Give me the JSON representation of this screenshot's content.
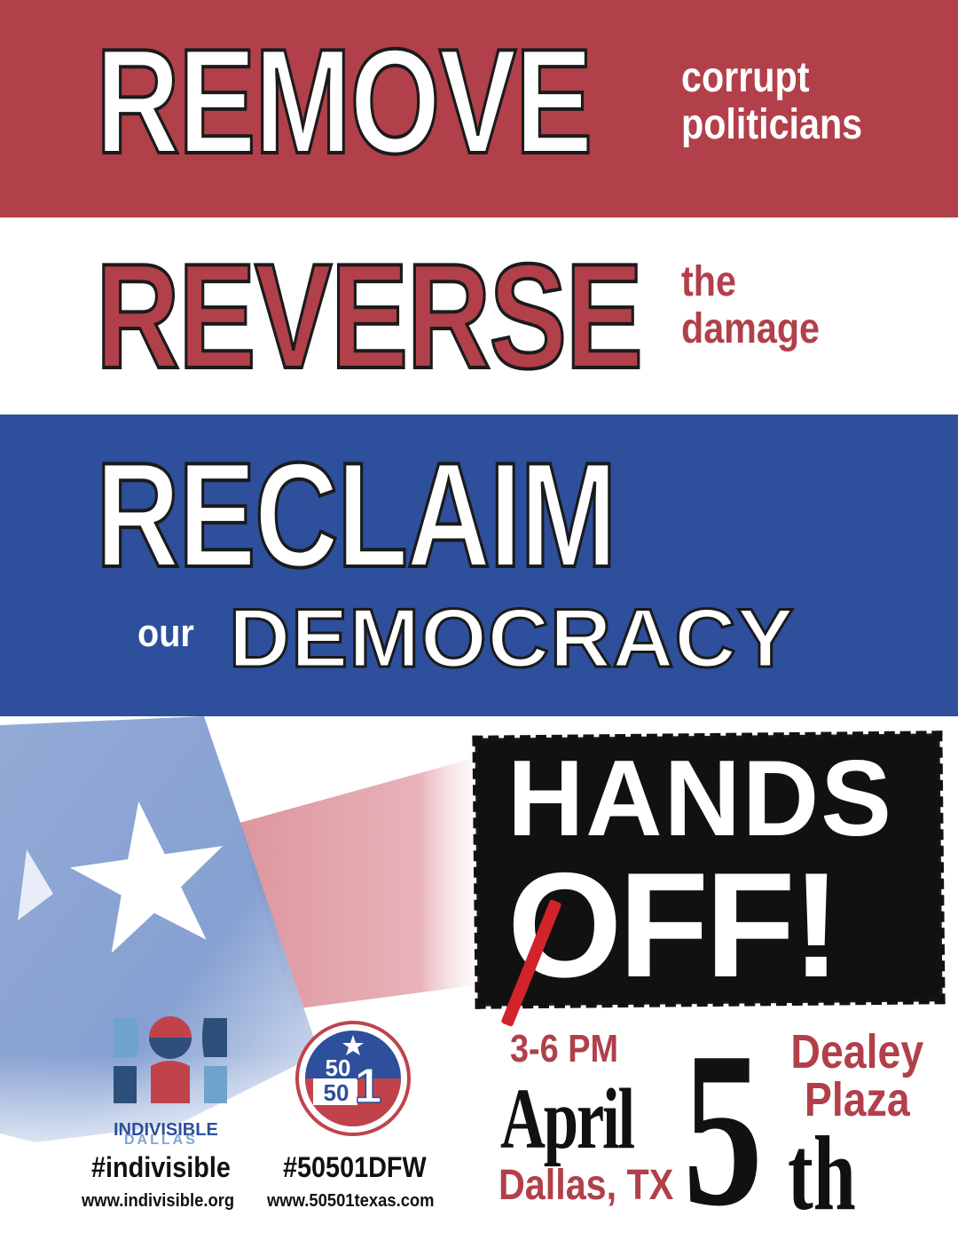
{
  "headline": {
    "remove": "REMOVE",
    "remove_sub_1": "corrupt",
    "remove_sub_2": "politicians",
    "reverse": "REVERSE",
    "reverse_sub_1": "the",
    "reverse_sub_2": "damage",
    "reclaim": "RECLAIM",
    "our": "our",
    "democracy": "DEMOCRACY"
  },
  "banner": {
    "hands": "HANDS",
    "off": "OFF!"
  },
  "event": {
    "time": "3-6 PM",
    "month": "April",
    "day": "5",
    "day_suffix": "th",
    "city": "Dallas, TX",
    "venue_line_1": "Dealey",
    "venue_line_2": "Plaza"
  },
  "orgs": {
    "indivisible": {
      "logo_name": "INDIVISIBLE",
      "logo_sub": "DALLAS",
      "hashtag": "#indivisible",
      "url": "www.indivisible.org"
    },
    "fifty501": {
      "logo_top": "50",
      "logo_bottom": "50",
      "logo_one": "1",
      "hashtag": "#50501DFW",
      "url": "www.50501texas.com"
    }
  },
  "colors": {
    "red": "#b1404a",
    "blue": "#2d4f9c",
    "white": "#ffffff",
    "black": "#111111",
    "slash_red": "#d2232a"
  }
}
